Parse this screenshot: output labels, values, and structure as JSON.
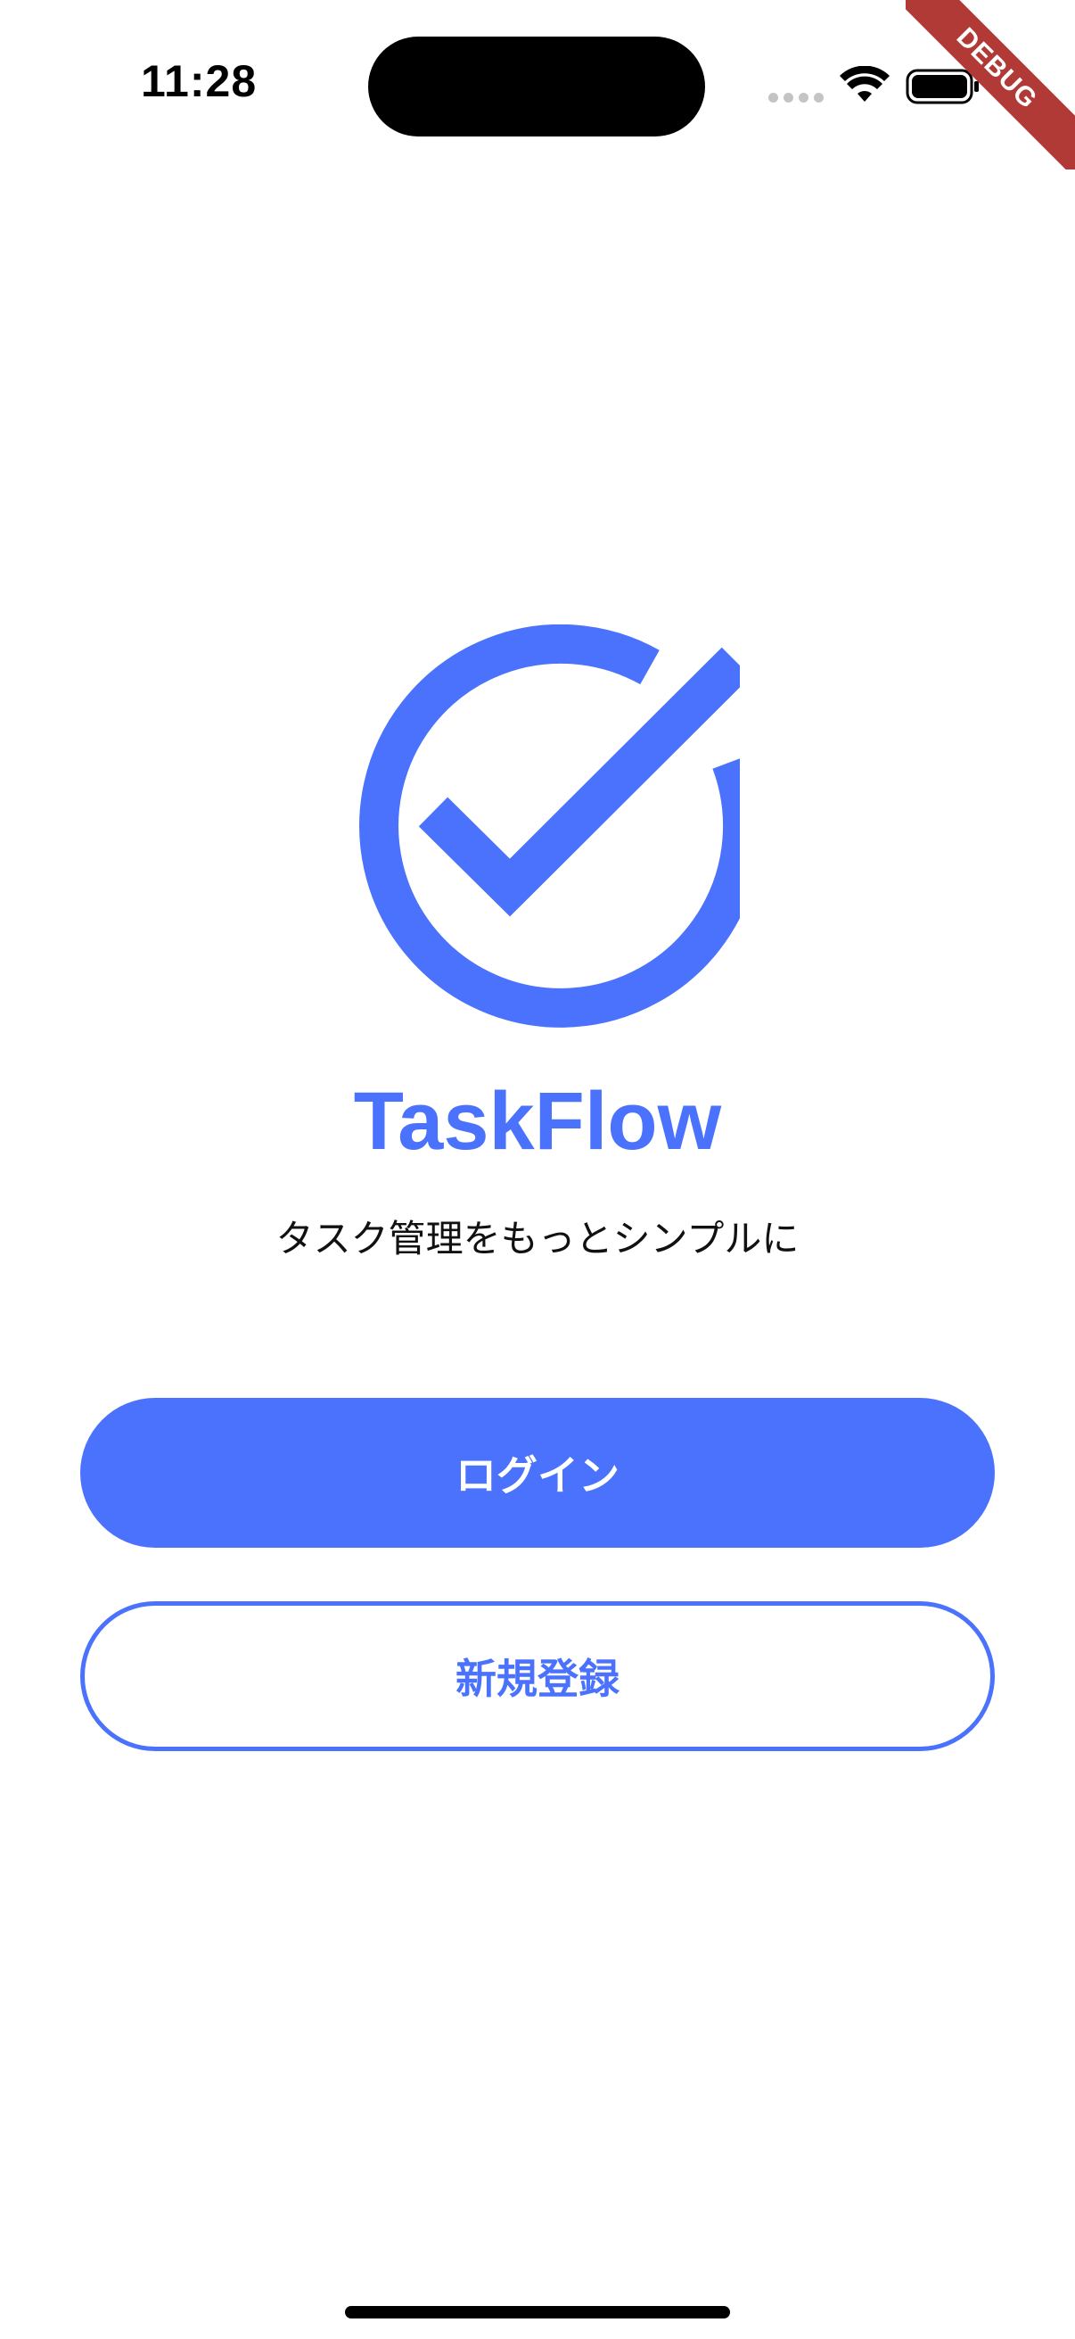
{
  "status_bar": {
    "time": "11:28"
  },
  "debug_banner": {
    "label": "DEBUG",
    "color": "#b23a36"
  },
  "app": {
    "name": "TaskFlow",
    "tagline": "タスク管理をもっとシンプルに",
    "logo_icon": "check-circle-icon",
    "accent_color": "#4a72fc"
  },
  "actions": {
    "login_label": "ログイン",
    "register_label": "新規登録"
  }
}
